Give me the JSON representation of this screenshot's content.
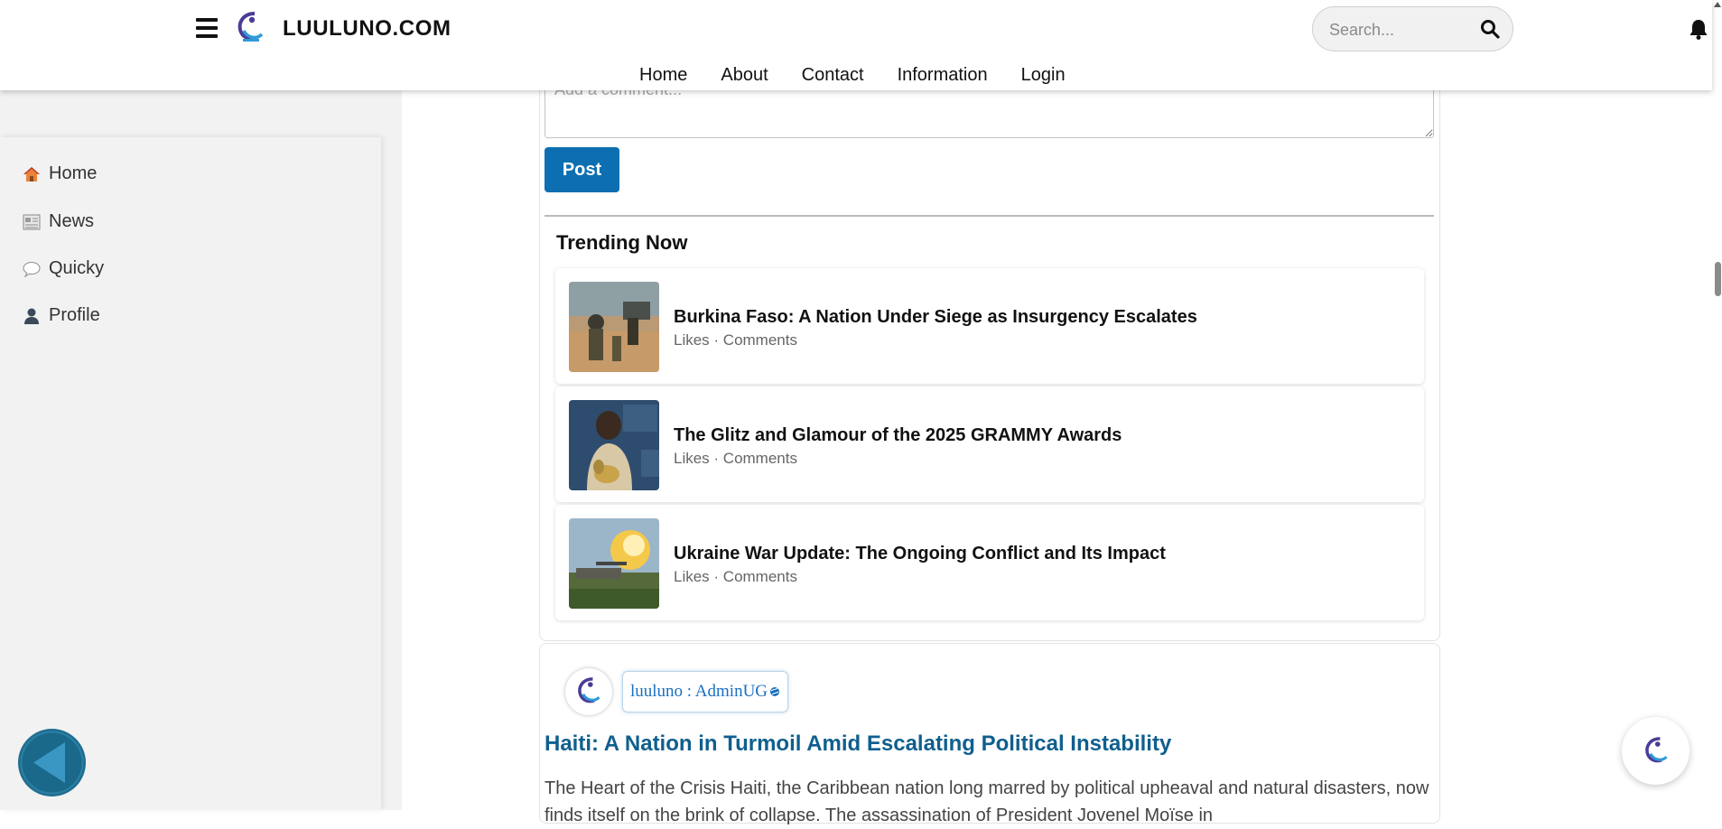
{
  "header": {
    "brand": "LUULUNO.COM",
    "search_placeholder": "Search...",
    "nav": [
      "Home",
      "About",
      "Contact",
      "Information",
      "Login"
    ]
  },
  "sidebar": {
    "items": [
      {
        "label": "Home",
        "icon": "house-icon"
      },
      {
        "label": "News",
        "icon": "newspaper-icon"
      },
      {
        "label": "Quicky",
        "icon": "speech-bubble-icon"
      },
      {
        "label": "Profile",
        "icon": "user-icon"
      }
    ]
  },
  "comment": {
    "placeholder": "Add a comment...",
    "post_label": "Post"
  },
  "trending": {
    "title": "Trending Now",
    "items": [
      {
        "title": "Burkina Faso: A Nation Under Siege as Insurgency Escalates",
        "meta": "Likes · Comments"
      },
      {
        "title": "The Glitz and Glamour of the 2025 GRAMMY Awards",
        "meta": "Likes · Comments"
      },
      {
        "title": "Ukraine War Update: The Ongoing Conflict and Its Impact",
        "meta": "Likes · Comments"
      }
    ]
  },
  "post": {
    "author": "luuluno : AdminUG",
    "title": "Haiti: A Nation in Turmoil Amid Escalating Political Instability",
    "excerpt": "The Heart of the Crisis Haiti, the Caribbean nation long marred by political upheaval and natural disasters, now finds itself on the brink of collapse. The assassination of President Jovenel Moïse in"
  },
  "colors": {
    "accent": "#0d6fb2",
    "post_title": "#0f5f8e",
    "sidebar_bg": "#f2f2f2",
    "back_button": "#1f6e91"
  }
}
